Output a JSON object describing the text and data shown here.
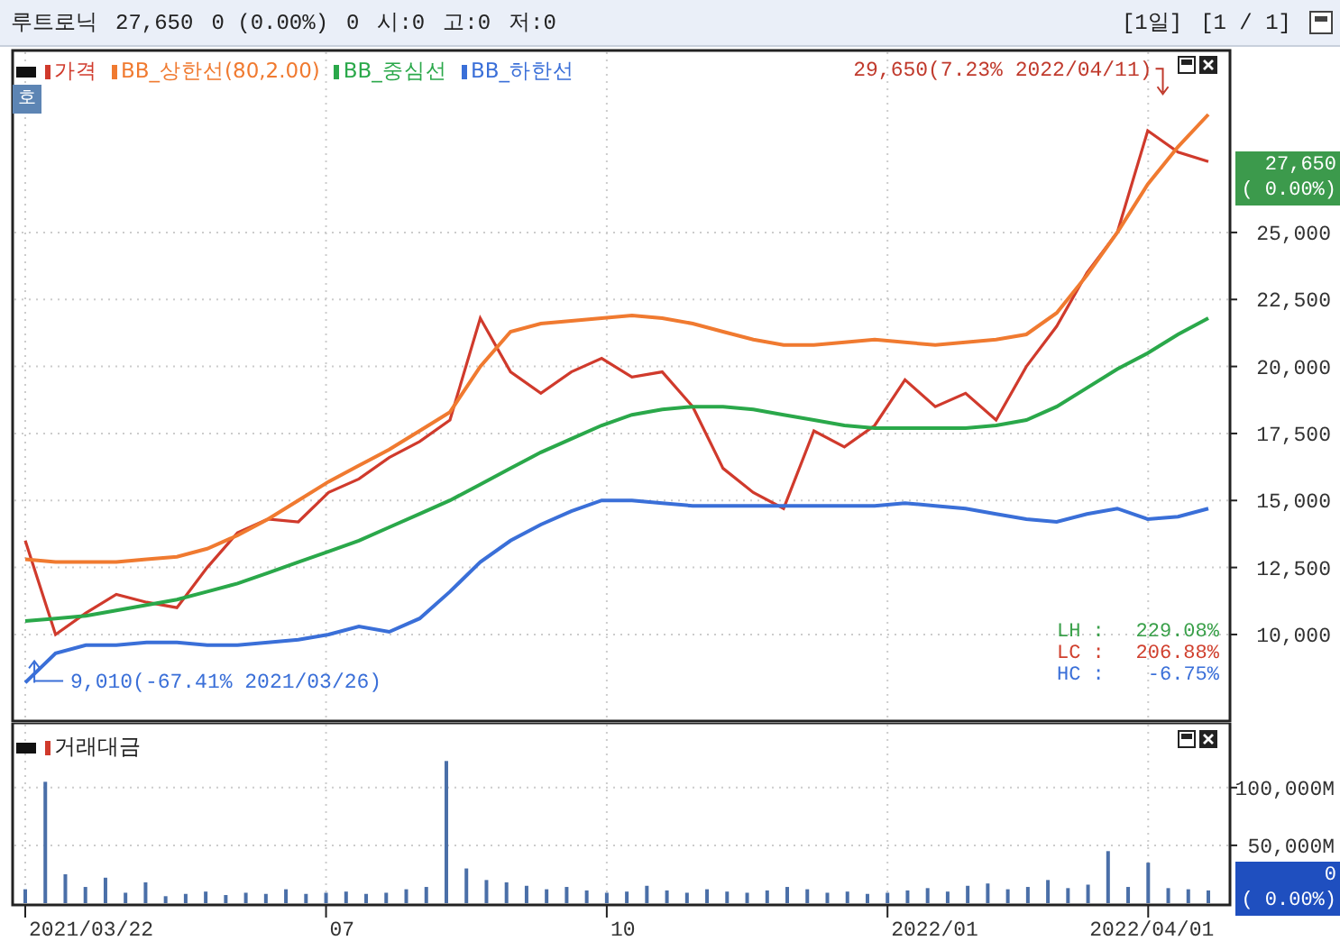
{
  "header": {
    "stock_name": "루트로닉",
    "price": "27,650",
    "change": "0 (0.00%)",
    "volume": "0",
    "open": "시:0",
    "high": "고:0",
    "low": "저:0",
    "period": "[1일]",
    "page": "[1 / 1]"
  },
  "price_panel": {
    "quote_button": "호",
    "current_price": "27,650",
    "current_change": "( 0.00%)",
    "stats": [
      {
        "label": "LH :",
        "value": "229.08%",
        "color": "#3aa04a"
      },
      {
        "label": "LC :",
        "value": "206.88%",
        "color": "#d0402e"
      },
      {
        "label": "HC :",
        "value": "-6.75%",
        "color": "#3a6fd8"
      }
    ],
    "markers": [
      "29,650(7.23% 2022/04/11)",
      "9,010(-67.41% 2021/03/26)"
    ],
    "chart_data": {
      "type": "line",
      "grid": true,
      "ylim": [
        6770,
        31790
      ],
      "yticks": [
        {
          "value": 10000,
          "label": "10,000"
        },
        {
          "value": 12500,
          "label": "12,500"
        },
        {
          "value": 15000,
          "label": "15,000"
        },
        {
          "value": 17500,
          "label": "17,500"
        },
        {
          "value": 20000,
          "label": "20,000"
        },
        {
          "value": 22500,
          "label": "22,500"
        },
        {
          "value": 25000,
          "label": "25,000"
        }
      ],
      "series": [
        {
          "name": "가격",
          "color": "#d03a2c",
          "values": [
            13500,
            10000,
            10800,
            11500,
            11200,
            11000,
            12500,
            13800,
            14300,
            14200,
            15300,
            15800,
            16600,
            17200,
            18000,
            21800,
            19800,
            19000,
            19800,
            20300,
            19600,
            19800,
            18500,
            16200,
            15300,
            14700,
            17600,
            17000,
            17800,
            19500,
            18500,
            19000,
            18000,
            20000,
            21500,
            23500,
            25000,
            28800,
            28000,
            27650
          ]
        },
        {
          "name": "BB_상한선(80,2.00)",
          "color": "#f07a30",
          "values": [
            12800,
            12700,
            12700,
            12700,
            12800,
            12900,
            13200,
            13700,
            14300,
            15000,
            15700,
            16300,
            16900,
            17600,
            18300,
            20000,
            21300,
            21600,
            21700,
            21800,
            21900,
            21800,
            21600,
            21300,
            21000,
            20800,
            20800,
            20900,
            21000,
            20900,
            20800,
            20900,
            21000,
            21200,
            22000,
            23400,
            25000,
            26800,
            28200,
            29400
          ]
        },
        {
          "name": "BB_중심선",
          "color": "#2aa84a",
          "values": [
            10500,
            10600,
            10700,
            10900,
            11100,
            11300,
            11600,
            11900,
            12300,
            12700,
            13100,
            13500,
            14000,
            14500,
            15000,
            15600,
            16200,
            16800,
            17300,
            17800,
            18200,
            18400,
            18500,
            18500,
            18400,
            18200,
            18000,
            17800,
            17700,
            17700,
            17700,
            17700,
            17800,
            18000,
            18500,
            19200,
            19900,
            20500,
            21200,
            21800
          ]
        },
        {
          "name": "BB_하한선",
          "color": "#3a6fd8",
          "values": [
            8200,
            9300,
            9600,
            9600,
            9700,
            9700,
            9600,
            9600,
            9700,
            9800,
            10000,
            10300,
            10100,
            10600,
            11600,
            12700,
            13500,
            14100,
            14600,
            15000,
            15000,
            14900,
            14800,
            14800,
            14800,
            14800,
            14800,
            14800,
            14800,
            14900,
            14800,
            14700,
            14500,
            14300,
            14200,
            14500,
            14700,
            14300,
            14400,
            14700
          ]
        }
      ]
    }
  },
  "volume_panel": {
    "current_value": "0",
    "current_change": "( 0.00%)",
    "date_labels": [
      "2021/03/22",
      "07",
      "10",
      "2022/01",
      "2022/04/01"
    ],
    "chart_data": {
      "type": "bar",
      "grid": true,
      "ylim": [
        0,
        156000
      ],
      "yticks": [
        {
          "value": 50000,
          "label": "50,000M"
        },
        {
          "value": 100000,
          "label": "100,000M"
        }
      ],
      "series": [
        {
          "name": "거래대금",
          "color": "#4a6fa8",
          "values": [
            12000,
            105000,
            25000,
            14000,
            22000,
            9000,
            18000,
            6000,
            8000,
            10000,
            7000,
            9000,
            8000,
            12000,
            8000,
            9000,
            10000,
            8000,
            9000,
            12000,
            14000,
            123000,
            30000,
            20000,
            18000,
            15000,
            12000,
            14000,
            11000,
            9000,
            10000,
            15000,
            11000,
            9000,
            12000,
            10000,
            9000,
            11000,
            14000,
            12000,
            9000,
            10000,
            8000,
            9000,
            11000,
            13000,
            10000,
            15000,
            17000,
            12000,
            14000,
            20000,
            13000,
            16000,
            45000,
            14000,
            35000,
            13000,
            12000,
            11000
          ]
        }
      ]
    }
  }
}
